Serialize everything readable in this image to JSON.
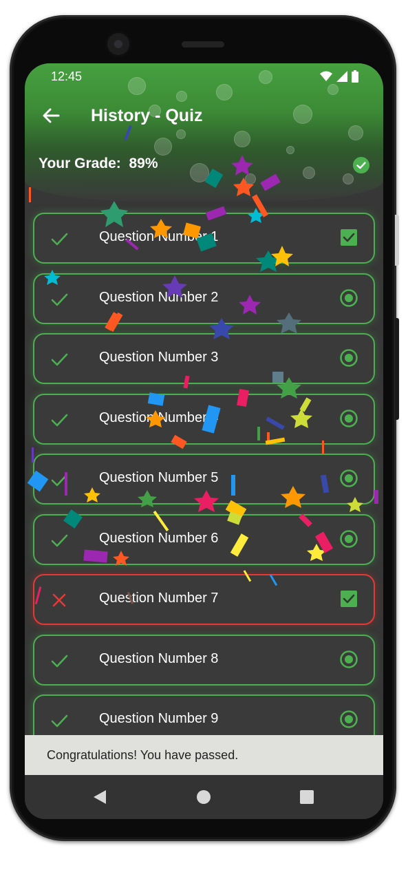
{
  "status_bar": {
    "time": "12:45"
  },
  "header": {
    "title": "History - Quiz",
    "grade_label": "Your Grade:",
    "grade_value": "89%"
  },
  "questions": [
    {
      "label": "Question Number 1",
      "result": "correct",
      "control": "checkbox-checked"
    },
    {
      "label": "Question Number 2",
      "result": "correct",
      "control": "radio-selected"
    },
    {
      "label": "Question Number 3",
      "result": "correct",
      "control": "radio-selected"
    },
    {
      "label": "Question Number 4",
      "result": "correct",
      "control": "radio-selected"
    },
    {
      "label": "Question Number 5",
      "result": "correct",
      "control": "radio-selected"
    },
    {
      "label": "Question Number 6",
      "result": "correct",
      "control": "radio-selected"
    },
    {
      "label": "Question Number 7",
      "result": "wrong",
      "control": "checkbox-checked"
    },
    {
      "label": "Question Number 8",
      "result": "correct",
      "control": "radio-selected"
    },
    {
      "label": "Question Number 9",
      "result": "correct",
      "control": "radio-selected"
    }
  ],
  "snackbar": {
    "message": "Congratulations! You have passed."
  },
  "colors": {
    "correct": "#4caf50",
    "wrong": "#e53935",
    "background": "#373737"
  },
  "icons": {
    "back": "arrow-left-icon",
    "grade": "check-circle-icon",
    "correct": "check-icon",
    "wrong": "close-icon",
    "checkbox": "checkbox-checked-icon",
    "radio": "radio-selected-icon"
  }
}
